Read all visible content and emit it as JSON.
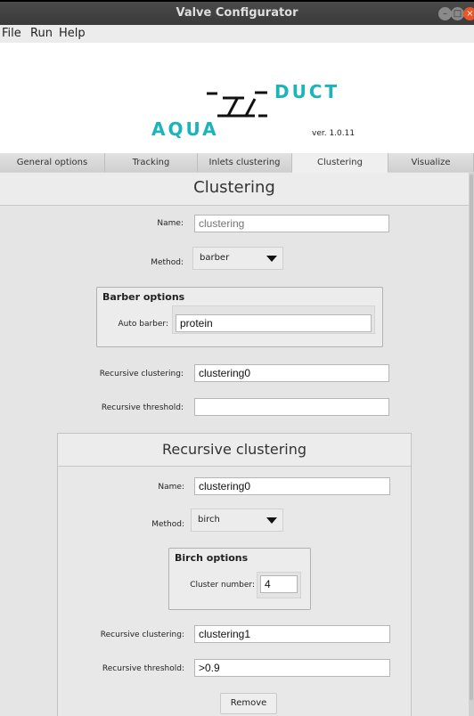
{
  "window": {
    "title": "Valve Configurator"
  },
  "menu": {
    "file": "File",
    "run": "Run",
    "help": "Help"
  },
  "logo": {
    "left_text": "AQUA",
    "right_text": "DUCT",
    "version": "ver. 1.0.11"
  },
  "tabs": [
    {
      "label": "General options"
    },
    {
      "label": "Tracking"
    },
    {
      "label": "Inlets clustering"
    },
    {
      "label": "Clustering"
    },
    {
      "label": "Visualize"
    }
  ],
  "clustering": {
    "heading": "Clustering",
    "name_label": "Name:",
    "name_placeholder": "clustering",
    "method_label": "Method:",
    "method_value": "barber",
    "barber_group_title": "Barber options",
    "auto_barber_label": "Auto barber:",
    "auto_barber_value": "protein",
    "recursive_clustering_label": "Recursive clustering:",
    "recursive_clustering_value": "clustering0",
    "recursive_threshold_label": "Recursive threshold:",
    "recursive_threshold_value": ""
  },
  "recursive": {
    "heading": "Recursive clustering",
    "name_label": "Name:",
    "name_value": "clustering0",
    "method_label": "Method:",
    "method_value": "birch",
    "birch_group_title": "Birch options",
    "cluster_number_label": "Cluster number:",
    "cluster_number_value": "4",
    "recursive_clustering_label": "Recursive clustering:",
    "recursive_clustering_value": "clustering1",
    "recursive_threshold_label": "Recursive threshold:",
    "recursive_threshold_value": ">0.9",
    "remove_label": "Remove"
  },
  "colors": {
    "accent_teal": "#1ab4bd",
    "close_button": "#e8552a",
    "titlebar": "#3f3f3f"
  }
}
